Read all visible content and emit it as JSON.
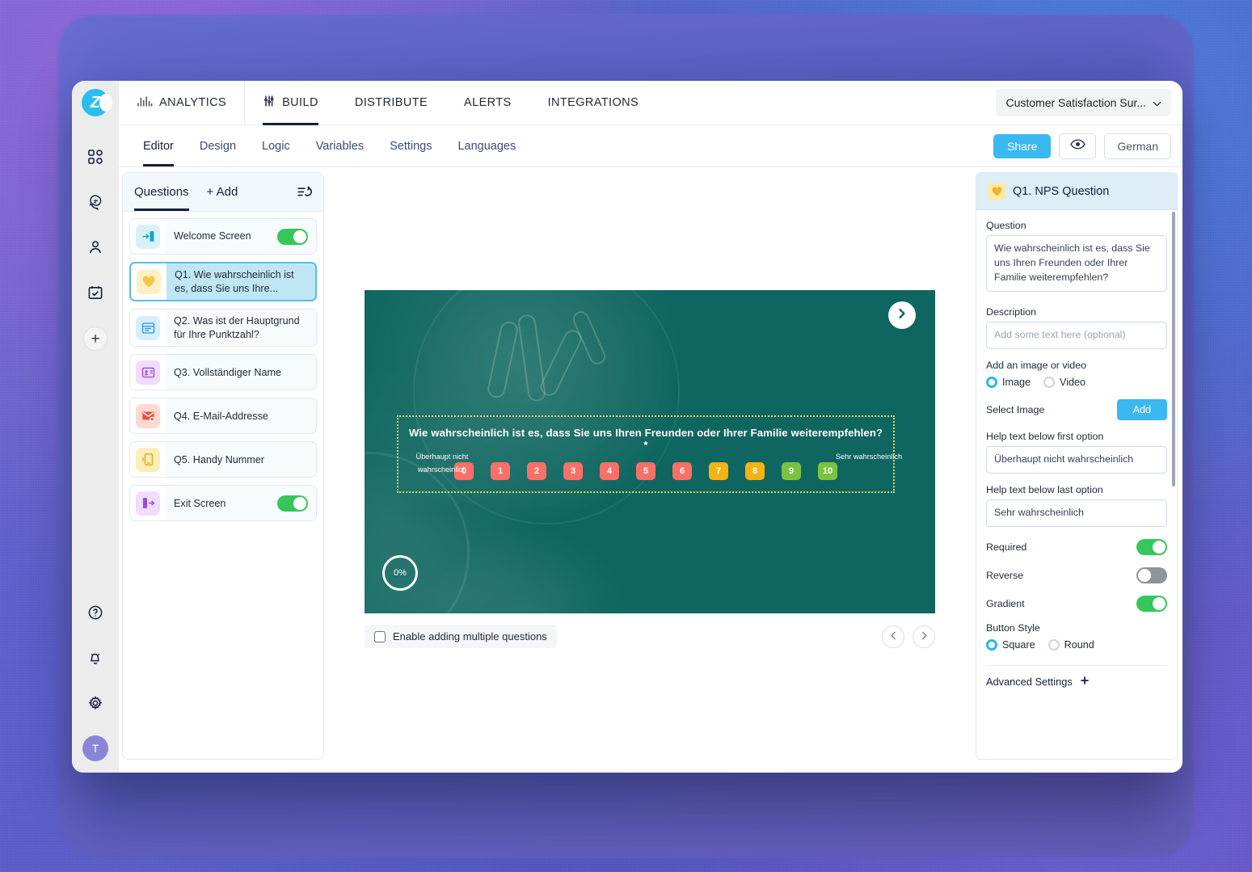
{
  "app": {
    "logo_letter": "Z",
    "logo_color": "#2bbdf0"
  },
  "rail": {
    "items": [
      {
        "name": "dashboard-icon",
        "label": "Dashboard"
      },
      {
        "name": "messages-icon",
        "label": "Messages"
      },
      {
        "name": "contacts-icon",
        "label": "Contacts"
      },
      {
        "name": "tasks-icon",
        "label": "Tasks"
      }
    ],
    "add_label": "+",
    "bottom": [
      {
        "name": "help-icon",
        "label": "Help"
      },
      {
        "name": "notifications-icon",
        "label": "Notifications"
      },
      {
        "name": "settings-icon",
        "label": "Settings"
      }
    ],
    "avatar_initial": "T"
  },
  "topnav": {
    "items": [
      {
        "label": "ANALYTICS",
        "icon": "bar-chart-icon",
        "active": false
      },
      {
        "label": "BUILD",
        "icon": "tools-icon",
        "active": true
      },
      {
        "label": "DISTRIBUTE",
        "icon": "",
        "active": false
      },
      {
        "label": "ALERTS",
        "icon": "",
        "active": false
      },
      {
        "label": "INTEGRATIONS",
        "icon": "",
        "active": false
      }
    ],
    "survey_selector": "Customer Satisfaction Sur...",
    "survey_selector_chevron": "chevron-down-icon"
  },
  "subnav": {
    "items": [
      {
        "label": "Editor",
        "active": true
      },
      {
        "label": "Design",
        "active": false
      },
      {
        "label": "Logic",
        "active": false
      },
      {
        "label": "Variables",
        "active": false
      },
      {
        "label": "Settings",
        "active": false
      },
      {
        "label": "Languages",
        "active": false
      }
    ],
    "share_label": "Share",
    "share_color": "#3bb8f0",
    "preview_icon": "eye-icon",
    "language_label": "German"
  },
  "questions_panel": {
    "tab_label": "Questions",
    "add_label": "+ Add",
    "reorder_icon": "reorder-undo-icon",
    "items": [
      {
        "label": "Welcome Screen",
        "icon": "enter-door-icon",
        "icon_bg": "#d6f2f7",
        "icon_color": "#19a6c4",
        "toggle": "on",
        "selected": false
      },
      {
        "label": "Q1. Wie wahrscheinlich ist es, dass Sie uns Ihre...",
        "icon": "heart-icon",
        "icon_bg": "#fdf0c3",
        "icon_color": "#f6c445",
        "toggle": "none",
        "selected": true
      },
      {
        "label": "Q2. Was ist der Hauptgrund für Ihre Punktzahl?",
        "icon": "text-box-icon",
        "icon_bg": "#d9eefb",
        "icon_color": "#2d9ede",
        "toggle": "none",
        "selected": false
      },
      {
        "label": "Q3. Vollständiger Name",
        "icon": "id-card-icon",
        "icon_bg": "#f0ddfb",
        "icon_color": "#a14fd6",
        "toggle": "none",
        "selected": false
      },
      {
        "label": "Q4. E-Mail-Addresse",
        "icon": "email-icon",
        "icon_bg": "#fdd9d2",
        "icon_color": "#e8523c",
        "toggle": "none",
        "selected": false
      },
      {
        "label": "Q5. Handy Nummer",
        "icon": "phone-icon",
        "icon_bg": "#fdedb8",
        "icon_color": "#e2ae22",
        "toggle": "none",
        "selected": false
      },
      {
        "label": "Exit Screen",
        "icon": "exit-door-icon",
        "icon_bg": "#f0ddfb",
        "icon_color": "#9a4bd0",
        "toggle": "on",
        "selected": false
      }
    ]
  },
  "canvas": {
    "background_color": "#0f6660",
    "next_icon": "chevron-right-icon",
    "question_text": "Wie wahrscheinlich ist es, dass Sie uns Ihren Freunden oder Ihrer Familie weiterempfehlen? *",
    "scale": [
      {
        "value": "0",
        "color": "#f97068"
      },
      {
        "value": "1",
        "color": "#f97068"
      },
      {
        "value": "2",
        "color": "#f97068"
      },
      {
        "value": "3",
        "color": "#f97068"
      },
      {
        "value": "4",
        "color": "#f97068"
      },
      {
        "value": "5",
        "color": "#f97068"
      },
      {
        "value": "6",
        "color": "#f97068"
      },
      {
        "value": "7",
        "color": "#f3b312"
      },
      {
        "value": "8",
        "color": "#f3b312"
      },
      {
        "value": "9",
        "color": "#79c341"
      },
      {
        "value": "10",
        "color": "#79c341"
      }
    ],
    "help_first": "Überhaupt nicht wahrscheinlich",
    "help_last": "Sehr wahrscheinlich",
    "progress": "0%",
    "multiple_questions_label": "Enable adding multiple questions",
    "multiple_questions_checked": false,
    "prev_icon": "chevron-left-icon",
    "page_next_icon": "chevron-right-icon"
  },
  "settings_panel": {
    "header_icon": "heart-icon",
    "header_title": "Q1. NPS Question",
    "question_label": "Question",
    "question_value": "Wie wahrscheinlich ist es, dass Sie uns Ihren Freunden oder Ihrer Familie weiterempfehlen?",
    "description_label": "Description",
    "description_value": "",
    "description_placeholder": "Add some text here (optional)",
    "media_label": "Add an image or video",
    "media_options": [
      {
        "label": "Image",
        "selected": true
      },
      {
        "label": "Video",
        "selected": false
      }
    ],
    "select_image_label": "Select Image",
    "add_button_label": "Add",
    "help_first_label": "Help text below first option",
    "help_first_value": "Überhaupt nicht wahrscheinlich",
    "help_last_label": "Help text below last option",
    "help_last_value": "Sehr wahrscheinlich",
    "toggles": [
      {
        "label": "Required",
        "state": "on"
      },
      {
        "label": "Reverse",
        "state": "off"
      },
      {
        "label": "Gradient",
        "state": "on"
      }
    ],
    "button_style_label": "Button Style",
    "button_style_options": [
      {
        "label": "Square",
        "selected": true
      },
      {
        "label": "Round",
        "selected": false
      }
    ],
    "advanced_label": "Advanced Settings",
    "advanced_icon": "plus-icon"
  }
}
